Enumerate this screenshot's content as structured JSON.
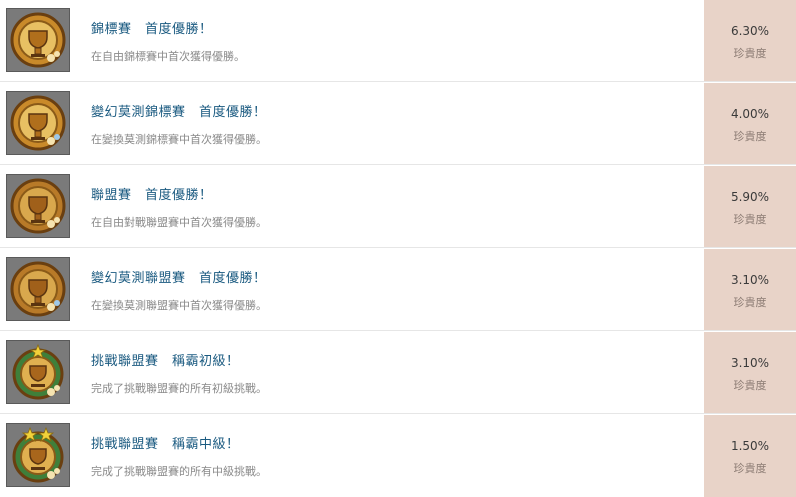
{
  "rarity_label": "珍貴度",
  "achievements": [
    {
      "title": "錦標賽　首度優勝！",
      "description": "在自由錦標賽中首次獲得優勝。",
      "rarity": "6.30%",
      "icon": "trophy-badge-icon"
    },
    {
      "title": "變幻莫測錦標賽　首度優勝！",
      "description": "在變換莫測錦標賽中首次獲得優勝。",
      "rarity": "4.00%",
      "icon": "trophy-badge-icon"
    },
    {
      "title": "聯盟賽　首度優勝！",
      "description": "在自由對戰聯盟賽中首次獲得優勝。",
      "rarity": "5.90%",
      "icon": "trophy-badge-icon"
    },
    {
      "title": "變幻莫測聯盟賽　首度優勝！",
      "description": "在變換莫測聯盟賽中首次獲得優勝。",
      "rarity": "3.10%",
      "icon": "trophy-badge-icon"
    },
    {
      "title": "挑戰聯盟賽　稱霸初級！",
      "description": "完成了挑戰聯盟賽的所有初級挑戰。",
      "rarity": "3.10%",
      "icon": "star-trophy-badge-icon"
    },
    {
      "title": "挑戰聯盟賽　稱霸中級！",
      "description": "完成了挑戰聯盟賽的所有中級挑戰。",
      "rarity": "1.50%",
      "icon": "star-trophy-badge-icon"
    }
  ],
  "colors": {
    "title": "#1a5a80",
    "description": "#8a8a8a",
    "rarity_bg": "#e8d3c8"
  }
}
